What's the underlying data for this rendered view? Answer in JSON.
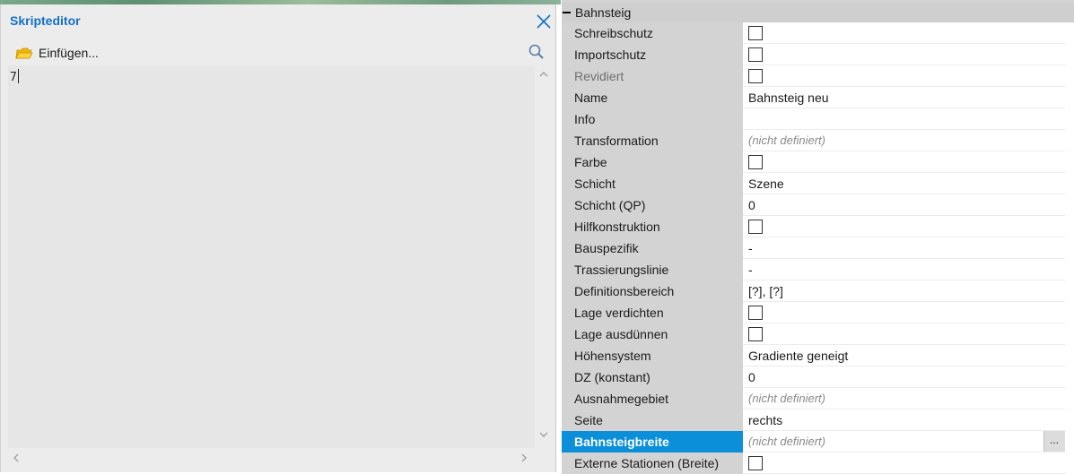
{
  "editor": {
    "title": "Skripteditor",
    "insert_label": "Einfügen...",
    "code": "7"
  },
  "properties": {
    "group_title": "Bahnsteig",
    "rows": [
      {
        "label": "Schreibschutz",
        "type": "checkbox",
        "checked": false
      },
      {
        "label": "Importschutz",
        "type": "checkbox",
        "checked": false
      },
      {
        "label": "Revidiert",
        "type": "checkbox",
        "checked": false,
        "dim": true
      },
      {
        "label": "Name",
        "type": "text",
        "value": "Bahnsteig neu"
      },
      {
        "label": "Info",
        "type": "text",
        "value": ""
      },
      {
        "label": "Transformation",
        "type": "undefined",
        "value": "(nicht definiert)"
      },
      {
        "label": "Farbe",
        "type": "checkbox",
        "checked": false
      },
      {
        "label": "Schicht",
        "type": "text",
        "value": "Szene"
      },
      {
        "label": "Schicht (QP)",
        "type": "text",
        "value": "0"
      },
      {
        "label": "Hilfkonstruktion",
        "type": "checkbox",
        "checked": false
      },
      {
        "label": "Bauspezifik",
        "type": "text",
        "value": "-"
      },
      {
        "label": "Trassierungslinie",
        "type": "text",
        "value": "-"
      },
      {
        "label": "Definitionsbereich",
        "type": "text",
        "value": "[?], [?]"
      },
      {
        "label": "Lage verdichten",
        "type": "checkbox",
        "checked": false
      },
      {
        "label": "Lage ausdünnen",
        "type": "checkbox",
        "checked": false
      },
      {
        "label": "Höhensystem",
        "type": "text",
        "value": "Gradiente geneigt"
      },
      {
        "label": "DZ (konstant)",
        "type": "text",
        "value": "0"
      },
      {
        "label": "Ausnahmegebiet",
        "type": "undefined",
        "value": "(nicht definiert)"
      },
      {
        "label": "Seite",
        "type": "text",
        "value": "rechts"
      },
      {
        "label": "Bahnsteigbreite",
        "type": "undefined",
        "value": "(nicht definiert)",
        "selected": true,
        "button": "..."
      },
      {
        "label": "Externe Stationen (Breite)",
        "type": "checkbox",
        "checked": false
      }
    ]
  },
  "colors": {
    "title_blue": "#1570c4",
    "selection_blue": "#0a8fd8"
  },
  "icons": [
    "close-icon",
    "folder-icon",
    "search-icon",
    "chevron-up-icon",
    "chevron-down-icon",
    "chevron-left-icon",
    "chevron-right-icon",
    "collapse-icon"
  ]
}
